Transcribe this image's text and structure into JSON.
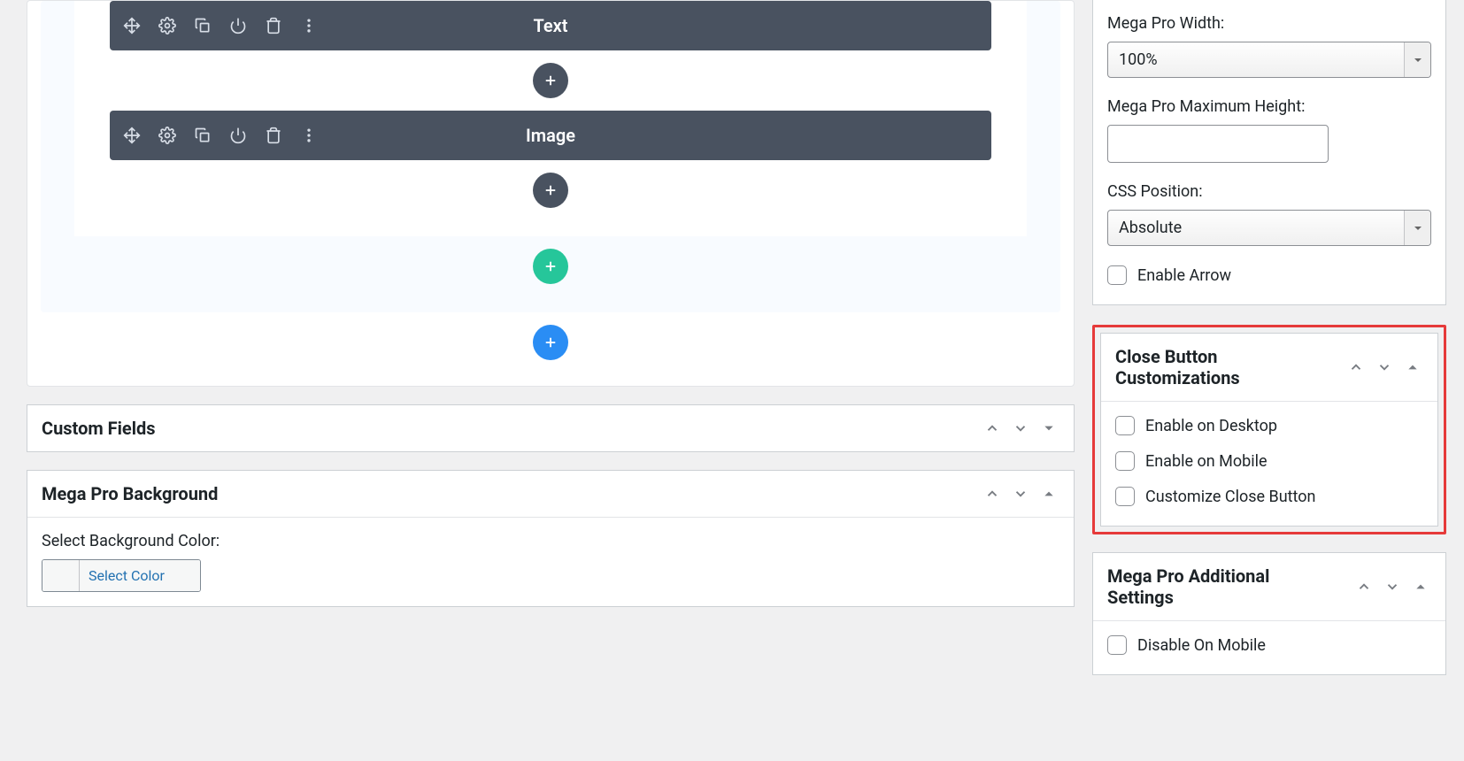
{
  "editor": {
    "widgets": [
      {
        "title": "Text"
      },
      {
        "title": "Image"
      }
    ]
  },
  "panels": {
    "custom_fields": {
      "title": "Custom Fields"
    },
    "mega_bg": {
      "title": "Mega Pro Background",
      "bg_label": "Select Background Color:",
      "select_color": "Select Color"
    }
  },
  "side": {
    "width_label": "Mega Pro Width:",
    "width_value": "100%",
    "max_height_label": "Mega Pro Maximum Height:",
    "max_height_value": "",
    "css_pos_label": "CSS Position:",
    "css_pos_value": "Absolute",
    "enable_arrow": "Enable Arrow",
    "close_panel": {
      "title": "Close Button Customizations",
      "opts": [
        "Enable on Desktop",
        "Enable on Mobile",
        "Customize Close Button"
      ]
    },
    "additional": {
      "title": "Mega Pro Additional Settings",
      "opts": [
        "Disable On Mobile"
      ]
    }
  }
}
